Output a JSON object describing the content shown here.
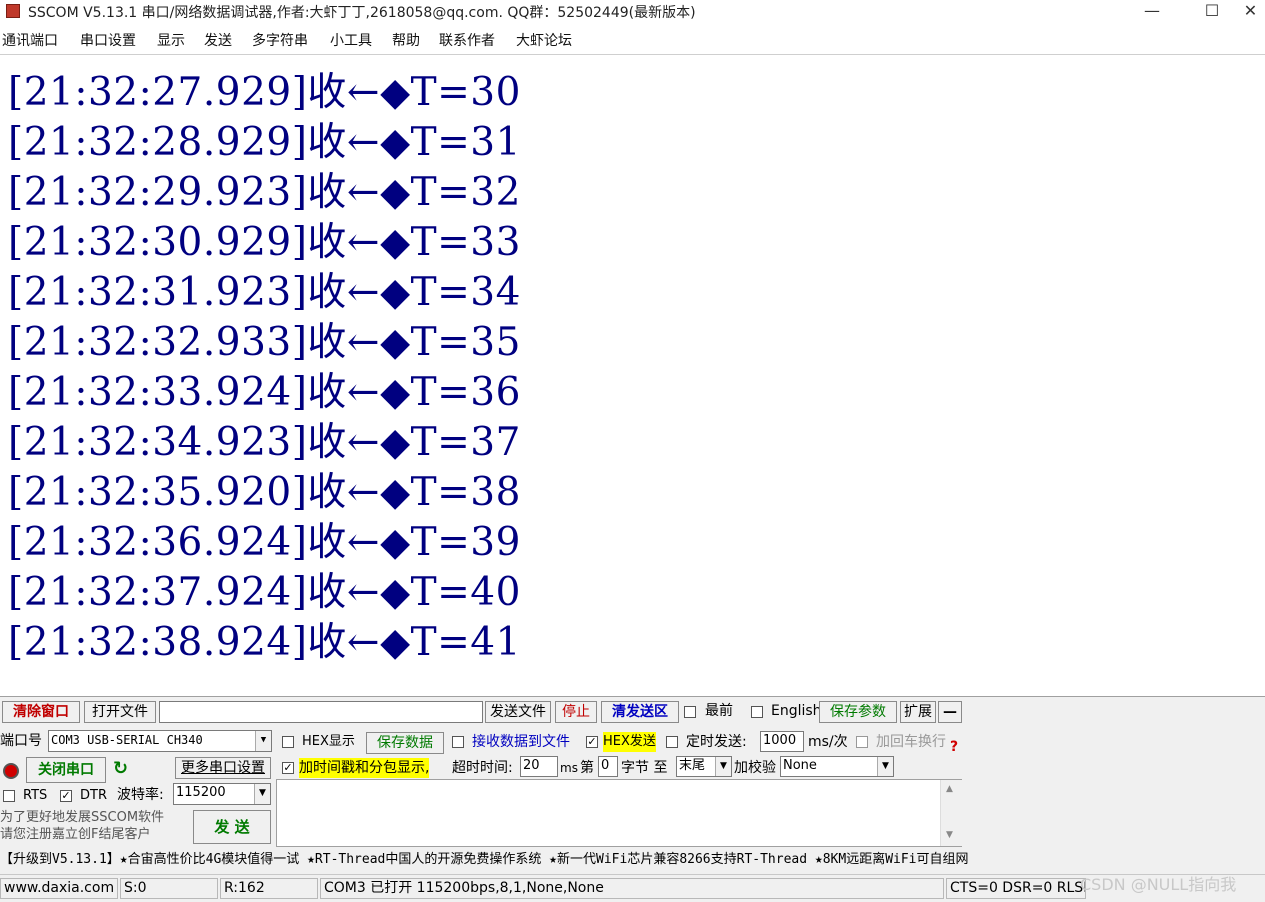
{
  "window": {
    "title": "SSCOM V5.13.1 串口/网络数据调试器,作者:大虾丁丁,2618058@qq.com. QQ群：52502449(最新版本)",
    "minimize": "—",
    "maximize": "☐",
    "close": "✕"
  },
  "menu": [
    "通讯端口",
    "串口设置",
    "显示",
    "发送",
    "多字符串",
    "小工具",
    "帮助",
    "联系作者",
    "大虾论坛"
  ],
  "receive": {
    "lines": [
      "[21:32:27.929]收←◆T=30",
      "[21:32:28.929]收←◆T=31",
      "[21:32:29.923]收←◆T=32",
      "[21:32:30.929]收←◆T=33",
      "[21:32:31.923]收←◆T=34",
      "[21:32:32.933]收←◆T=35",
      "[21:32:33.924]收←◆T=36",
      "[21:32:34.923]收←◆T=37",
      "[21:32:35.920]收←◆T=38",
      "[21:32:36.924]收←◆T=39",
      "[21:32:37.924]收←◆T=40",
      "[21:32:38.924]收←◆T=41"
    ]
  },
  "toolbar": {
    "clear_window": "清除窗口",
    "open_file": "打开文件",
    "file_path": "",
    "send_file": "发送文件",
    "stop": "停止",
    "clear_send": "清发送区",
    "topmost": "最前",
    "english": "English",
    "save_params": "保存参数",
    "expand": "扩展",
    "collapse": "—"
  },
  "port": {
    "port_label": "端口号",
    "port_value": "COM3 USB-SERIAL CH340",
    "close_port": "关闭串口",
    "more_settings": "更多串口设置",
    "rts": "RTS",
    "dtr": "DTR",
    "baud_label": "波特率:",
    "baud_value": "115200",
    "promo_line1": "为了更好地发展SSCOM软件",
    "promo_line2": "请您注册嘉立创F结尾客户",
    "send": "发 送"
  },
  "options": {
    "hex_display": "HEX显示",
    "save_data": "保存数据",
    "recv_to_file": "接收数据到文件",
    "hex_send": "HEX发送",
    "timed_send": "定时发送:",
    "interval": "1000",
    "interval_unit": "ms/次",
    "append_crlf": "加回车换行",
    "help_mark": "?",
    "timestamp": "加时间戳和分包显示,",
    "timeout_label": "超时时间:",
    "timeout_value": "20",
    "timeout_unit": "ms",
    "byte_from_label": "第",
    "byte_from_value": "0",
    "byte_unit": "字节 至",
    "byte_to_value": "末尾",
    "checksum_label": "加校验",
    "checksum_value": "None"
  },
  "send_area": {
    "text": ""
  },
  "ticker": "【升级到V5.13.1】★合宙高性价比4G模块值得一试 ★RT-Thread中国人的开源免费操作系统 ★新一代WiFi芯片兼容8266支持RT-Thread ★8KM远距离WiFi可自组网",
  "status": {
    "website": "www.daxia.com",
    "sent": "S:0",
    "received": "R:162",
    "port_state": "COM3 已打开  115200bps,8,1,None,None",
    "signals": "CTS=0 DSR=0 RLSD=0",
    "watermark": "CSDN @NULL指向我"
  }
}
